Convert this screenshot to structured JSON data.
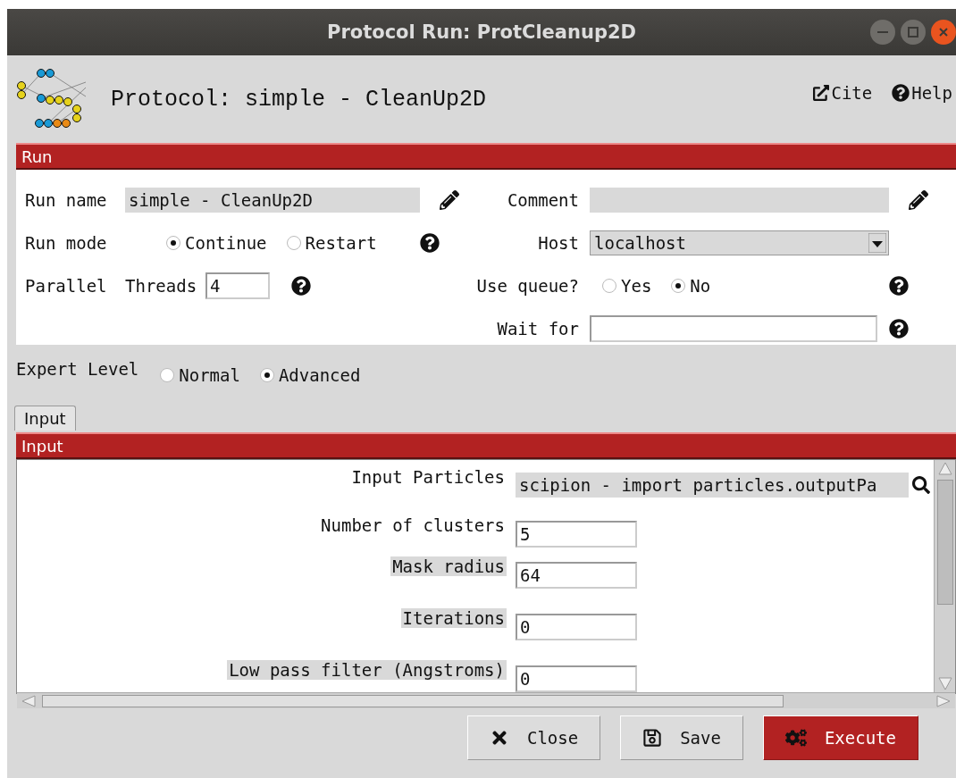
{
  "window": {
    "title": "Protocol Run: ProtCleanup2D"
  },
  "header": {
    "title": "Protocol: simple - CleanUp2D",
    "links": [
      {
        "label": "Cite",
        "kind": "cite"
      },
      {
        "label": "Help",
        "kind": "help"
      }
    ]
  },
  "run_section": {
    "title": "Run",
    "run_name": {
      "label": "Run name",
      "value": "simple - CleanUp2D"
    },
    "comment": {
      "label": "Comment"
    },
    "run_mode": {
      "label": "Run mode",
      "options": [
        {
          "label": "Continue",
          "selected": true
        },
        {
          "label": "Restart",
          "selected": false
        }
      ]
    },
    "host": {
      "label": "Host",
      "value": "localhost"
    },
    "parallel": {
      "label": "Parallel",
      "threads_label": "Threads",
      "threads_value": "4"
    },
    "use_queue": {
      "label": "Use queue?",
      "options": [
        {
          "label": "Yes",
          "selected": false
        },
        {
          "label": "No",
          "selected": true
        }
      ]
    },
    "wait_for": {
      "label": "Wait for"
    }
  },
  "expert_level": {
    "label": "Expert Level",
    "options": [
      {
        "label": "Normal",
        "selected": false
      },
      {
        "label": "Advanced",
        "selected": true
      }
    ]
  },
  "tabs": [
    {
      "label": "Input",
      "selected": true
    }
  ],
  "input_section": {
    "title": "Input",
    "params": [
      {
        "label": "Input Particles",
        "value": "scipion - import particles.outputPa",
        "kind": "pointer",
        "advanced": false
      },
      {
        "label": "Number of clusters",
        "value": "5",
        "kind": "text",
        "advanced": false
      },
      {
        "label": "Mask radius",
        "value": "64",
        "kind": "text",
        "advanced": true
      },
      {
        "label": "Iterations",
        "value": "0",
        "kind": "text",
        "advanced": true
      },
      {
        "label": "Low pass filter (Angstroms)",
        "value": "0",
        "kind": "text",
        "advanced": true
      }
    ]
  },
  "buttons": [
    {
      "label": "Close",
      "kind": "close"
    },
    {
      "label": "Save",
      "kind": "save"
    },
    {
      "label": "Execute",
      "kind": "execute"
    }
  ]
}
